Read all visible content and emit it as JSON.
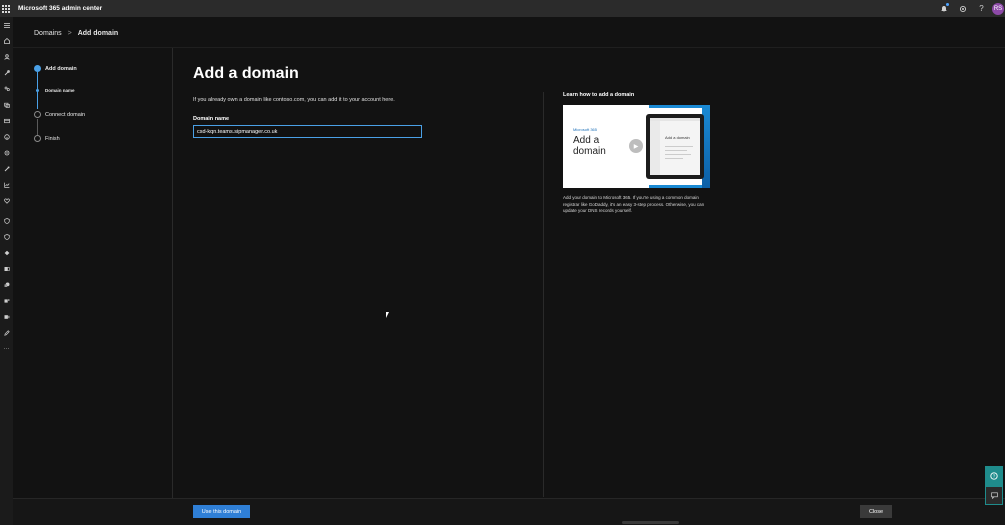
{
  "header": {
    "app_title": "Microsoft 365 admin center",
    "avatar_initials": "RS",
    "icons": [
      "waffle-icon",
      "notification-icon",
      "settings-icon",
      "help-icon"
    ]
  },
  "rail": {
    "icons": [
      "menu-icon",
      "home-icon",
      "users-icon",
      "devices-icon",
      "teams-icon",
      "groups-icon",
      "billing-icon",
      "setup-icon",
      "settings-icon",
      "configure-icon",
      "reports-icon",
      "health-icon",
      "security-icon",
      "compliance-icon",
      "endpoint-icon",
      "exchange-icon",
      "sharepoint-icon",
      "teams-admin-icon",
      "intune-icon",
      "edit-icon",
      "more-icon"
    ]
  },
  "breadcrumb": {
    "parent": "Domains",
    "separator": ">",
    "current": "Add domain"
  },
  "steps": {
    "items": [
      {
        "label": "Add domain",
        "state": "active"
      },
      {
        "label": "Domain name",
        "state": "substep"
      },
      {
        "label": "Connect domain",
        "state": "pending"
      },
      {
        "label": "Finish",
        "state": "pending"
      }
    ]
  },
  "main": {
    "title": "Add a domain",
    "intro": "If you already own a domain like contoso.com, you can add it to your account here.",
    "field_label": "Domain name",
    "field_value": "csd-kqn.teams.sipmanager.co.uk"
  },
  "learn": {
    "title": "Learn how to add a domain",
    "video_brand": "Microsoft 365",
    "video_headline": "Add a domain",
    "video_screen_label": "Add a domain",
    "description": "Add your domain to Microsoft 365. If you're using a common domain registrar like GoDaddy, it's an easy 3-step process. Otherwise, you can update your DNS records yourself."
  },
  "footer": {
    "primary_label": "Use this domain",
    "close_label": "Close"
  },
  "colors": {
    "accent": "#4aa0e6",
    "primary_button": "#2f7fd6",
    "background": "#111111",
    "help_teal": "#1f8c8c"
  }
}
